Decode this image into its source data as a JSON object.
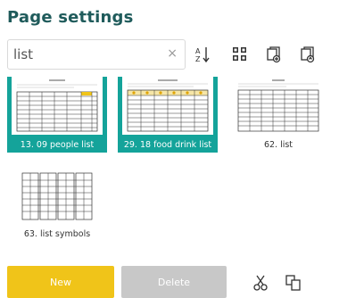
{
  "panel": {
    "title": "Page settings"
  },
  "search": {
    "value": "list",
    "clear_glyph": "×"
  },
  "toolbar": {
    "sort_icon": "sort-az-icon",
    "grid_icon": "grid-view-icon",
    "add_page_icon": "add-page-icon",
    "move_page_icon": "move-page-icon"
  },
  "pages": [
    {
      "label": "13. 09 people list",
      "selected": true
    },
    {
      "label": "29. 18 food drink list",
      "selected": true
    },
    {
      "label": "62. list",
      "selected": false
    },
    {
      "label": "63. list symbols",
      "selected": false
    }
  ],
  "footer": {
    "new_label": "New",
    "delete_label": "Delete"
  },
  "colors": {
    "accent": "#14a39a",
    "title": "#1f5b5b",
    "new_button": "#f0c419",
    "delete_button": "#c8c8c8"
  }
}
